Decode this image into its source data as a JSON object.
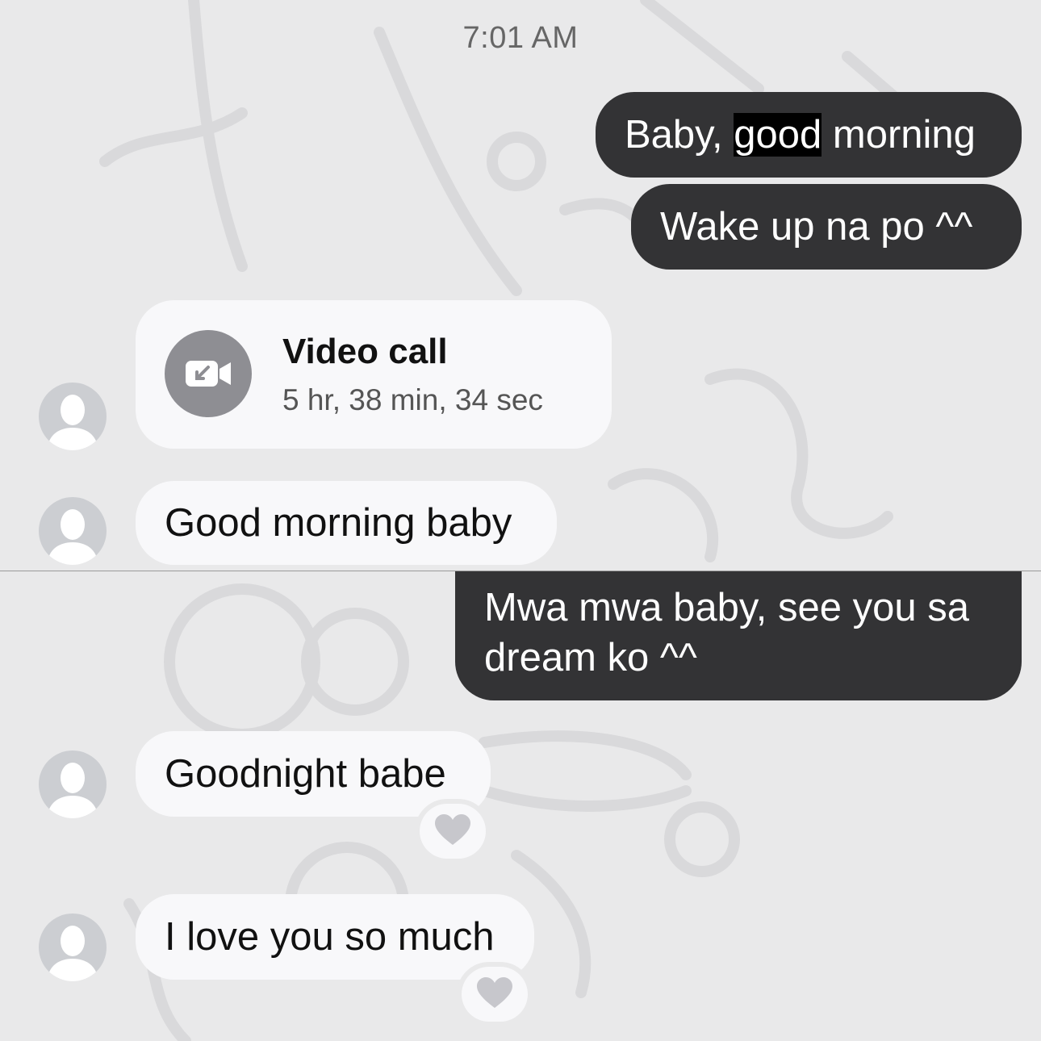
{
  "thread": {
    "timestamp": "7:01 AM",
    "messages": [
      {
        "side": "outgoing",
        "pre": "Baby, ",
        "highlight": "good",
        "post": " morning"
      },
      {
        "side": "outgoing",
        "text": "Wake up na po ^^"
      },
      {
        "side": "incoming",
        "type": "video-call",
        "title": "Video call",
        "duration": "5 hr, 38 min, 34 sec"
      },
      {
        "side": "incoming",
        "text": "Good morning baby"
      },
      {
        "side": "outgoing",
        "line1": "Mwa mwa baby, see you sa",
        "line2": "dream ko ^^"
      },
      {
        "side": "incoming",
        "text": "Goodnight babe",
        "reaction": "heart"
      },
      {
        "side": "incoming",
        "text": "I love you so much",
        "reaction": "heart"
      }
    ]
  },
  "colors": {
    "background": "#e9e9ea",
    "outgoing_bubble": "#333335",
    "incoming_bubble": "#f8f8fa",
    "call_icon_bg": "#8e8e93",
    "avatar": "#ccced2"
  },
  "icons": {
    "call": "video-camera-icon",
    "avatar": "person-silhouette-icon",
    "reaction": "heart-icon"
  }
}
